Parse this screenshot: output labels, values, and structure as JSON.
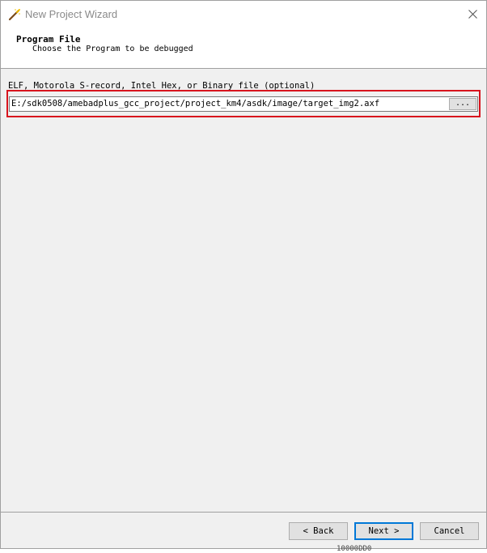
{
  "window": {
    "title": "New Project Wizard",
    "icon": "wizard-wand-icon",
    "close_icon": "close-icon"
  },
  "header": {
    "title": "Program File",
    "subtitle": "Choose the Program to be debugged"
  },
  "form": {
    "field_label": "ELF, Motorola S-record, Intel Hex, or Binary file (optional)",
    "path_value": "E:/sdk0508/amebadplus_gcc_project/project_km4/asdk/image/target_img2.axf",
    "browse_label": "..."
  },
  "footer": {
    "back_label": "< Back",
    "next_label": "Next >",
    "cancel_label": "Cancel"
  },
  "background": {
    "partial_text": "10000DD0"
  },
  "colors": {
    "highlight": "#d8141e",
    "default_button_border": "#0078d7"
  }
}
